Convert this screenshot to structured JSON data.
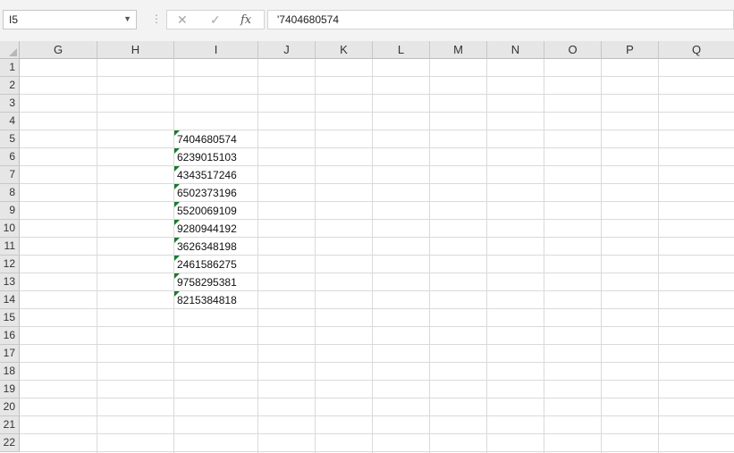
{
  "formula_bar": {
    "name_box": "I5",
    "separator": "⋮",
    "cancel_glyph": "✕",
    "enter_glyph": "✓",
    "fx_label": "fx",
    "formula": "'7404680574"
  },
  "columns": [
    "G",
    "H",
    "I",
    "J",
    "K",
    "L",
    "M",
    "N",
    "O",
    "P",
    "Q"
  ],
  "rows": [
    "1",
    "2",
    "3",
    "4",
    "5",
    "6",
    "7",
    "8",
    "9",
    "10",
    "11",
    "12",
    "13",
    "14",
    "15",
    "16",
    "17",
    "18",
    "19",
    "20",
    "21",
    "22"
  ],
  "column_i_values": [
    "7404680574",
    "6239015103",
    "4343517246",
    "6502373196",
    "5520069109",
    "9280944192",
    "3626348198",
    "2461586275",
    "9758295381",
    "8215384818"
  ],
  "colors": {
    "error_indicator": "#1a7a2e",
    "header_bg": "#e6e6e6",
    "gridline": "#dadada"
  }
}
